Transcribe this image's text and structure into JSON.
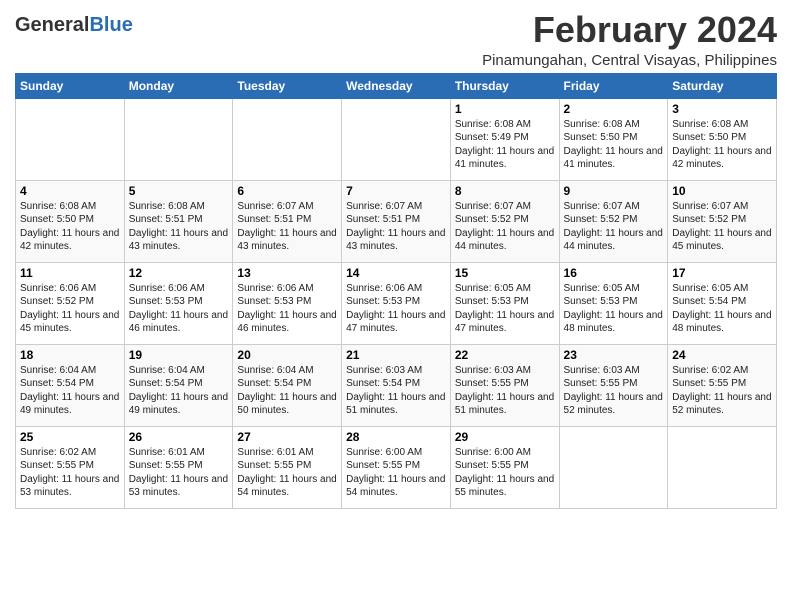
{
  "logo": {
    "general": "General",
    "blue": "Blue"
  },
  "title": "February 2024",
  "location": "Pinamungahan, Central Visayas, Philippines",
  "days_of_week": [
    "Sunday",
    "Monday",
    "Tuesday",
    "Wednesday",
    "Thursday",
    "Friday",
    "Saturday"
  ],
  "weeks": [
    [
      {
        "day": "",
        "info": ""
      },
      {
        "day": "",
        "info": ""
      },
      {
        "day": "",
        "info": ""
      },
      {
        "day": "",
        "info": ""
      },
      {
        "day": "1",
        "info": "Sunrise: 6:08 AM\nSunset: 5:49 PM\nDaylight: 11 hours and 41 minutes."
      },
      {
        "day": "2",
        "info": "Sunrise: 6:08 AM\nSunset: 5:50 PM\nDaylight: 11 hours and 41 minutes."
      },
      {
        "day": "3",
        "info": "Sunrise: 6:08 AM\nSunset: 5:50 PM\nDaylight: 11 hours and 42 minutes."
      }
    ],
    [
      {
        "day": "4",
        "info": "Sunrise: 6:08 AM\nSunset: 5:50 PM\nDaylight: 11 hours and 42 minutes."
      },
      {
        "day": "5",
        "info": "Sunrise: 6:08 AM\nSunset: 5:51 PM\nDaylight: 11 hours and 43 minutes."
      },
      {
        "day": "6",
        "info": "Sunrise: 6:07 AM\nSunset: 5:51 PM\nDaylight: 11 hours and 43 minutes."
      },
      {
        "day": "7",
        "info": "Sunrise: 6:07 AM\nSunset: 5:51 PM\nDaylight: 11 hours and 43 minutes."
      },
      {
        "day": "8",
        "info": "Sunrise: 6:07 AM\nSunset: 5:52 PM\nDaylight: 11 hours and 44 minutes."
      },
      {
        "day": "9",
        "info": "Sunrise: 6:07 AM\nSunset: 5:52 PM\nDaylight: 11 hours and 44 minutes."
      },
      {
        "day": "10",
        "info": "Sunrise: 6:07 AM\nSunset: 5:52 PM\nDaylight: 11 hours and 45 minutes."
      }
    ],
    [
      {
        "day": "11",
        "info": "Sunrise: 6:06 AM\nSunset: 5:52 PM\nDaylight: 11 hours and 45 minutes."
      },
      {
        "day": "12",
        "info": "Sunrise: 6:06 AM\nSunset: 5:53 PM\nDaylight: 11 hours and 46 minutes."
      },
      {
        "day": "13",
        "info": "Sunrise: 6:06 AM\nSunset: 5:53 PM\nDaylight: 11 hours and 46 minutes."
      },
      {
        "day": "14",
        "info": "Sunrise: 6:06 AM\nSunset: 5:53 PM\nDaylight: 11 hours and 47 minutes."
      },
      {
        "day": "15",
        "info": "Sunrise: 6:05 AM\nSunset: 5:53 PM\nDaylight: 11 hours and 47 minutes."
      },
      {
        "day": "16",
        "info": "Sunrise: 6:05 AM\nSunset: 5:53 PM\nDaylight: 11 hours and 48 minutes."
      },
      {
        "day": "17",
        "info": "Sunrise: 6:05 AM\nSunset: 5:54 PM\nDaylight: 11 hours and 48 minutes."
      }
    ],
    [
      {
        "day": "18",
        "info": "Sunrise: 6:04 AM\nSunset: 5:54 PM\nDaylight: 11 hours and 49 minutes."
      },
      {
        "day": "19",
        "info": "Sunrise: 6:04 AM\nSunset: 5:54 PM\nDaylight: 11 hours and 49 minutes."
      },
      {
        "day": "20",
        "info": "Sunrise: 6:04 AM\nSunset: 5:54 PM\nDaylight: 11 hours and 50 minutes."
      },
      {
        "day": "21",
        "info": "Sunrise: 6:03 AM\nSunset: 5:54 PM\nDaylight: 11 hours and 51 minutes."
      },
      {
        "day": "22",
        "info": "Sunrise: 6:03 AM\nSunset: 5:55 PM\nDaylight: 11 hours and 51 minutes."
      },
      {
        "day": "23",
        "info": "Sunrise: 6:03 AM\nSunset: 5:55 PM\nDaylight: 11 hours and 52 minutes."
      },
      {
        "day": "24",
        "info": "Sunrise: 6:02 AM\nSunset: 5:55 PM\nDaylight: 11 hours and 52 minutes."
      }
    ],
    [
      {
        "day": "25",
        "info": "Sunrise: 6:02 AM\nSunset: 5:55 PM\nDaylight: 11 hours and 53 minutes."
      },
      {
        "day": "26",
        "info": "Sunrise: 6:01 AM\nSunset: 5:55 PM\nDaylight: 11 hours and 53 minutes."
      },
      {
        "day": "27",
        "info": "Sunrise: 6:01 AM\nSunset: 5:55 PM\nDaylight: 11 hours and 54 minutes."
      },
      {
        "day": "28",
        "info": "Sunrise: 6:00 AM\nSunset: 5:55 PM\nDaylight: 11 hours and 54 minutes."
      },
      {
        "day": "29",
        "info": "Sunrise: 6:00 AM\nSunset: 5:55 PM\nDaylight: 11 hours and 55 minutes."
      },
      {
        "day": "",
        "info": ""
      },
      {
        "day": "",
        "info": ""
      }
    ]
  ]
}
